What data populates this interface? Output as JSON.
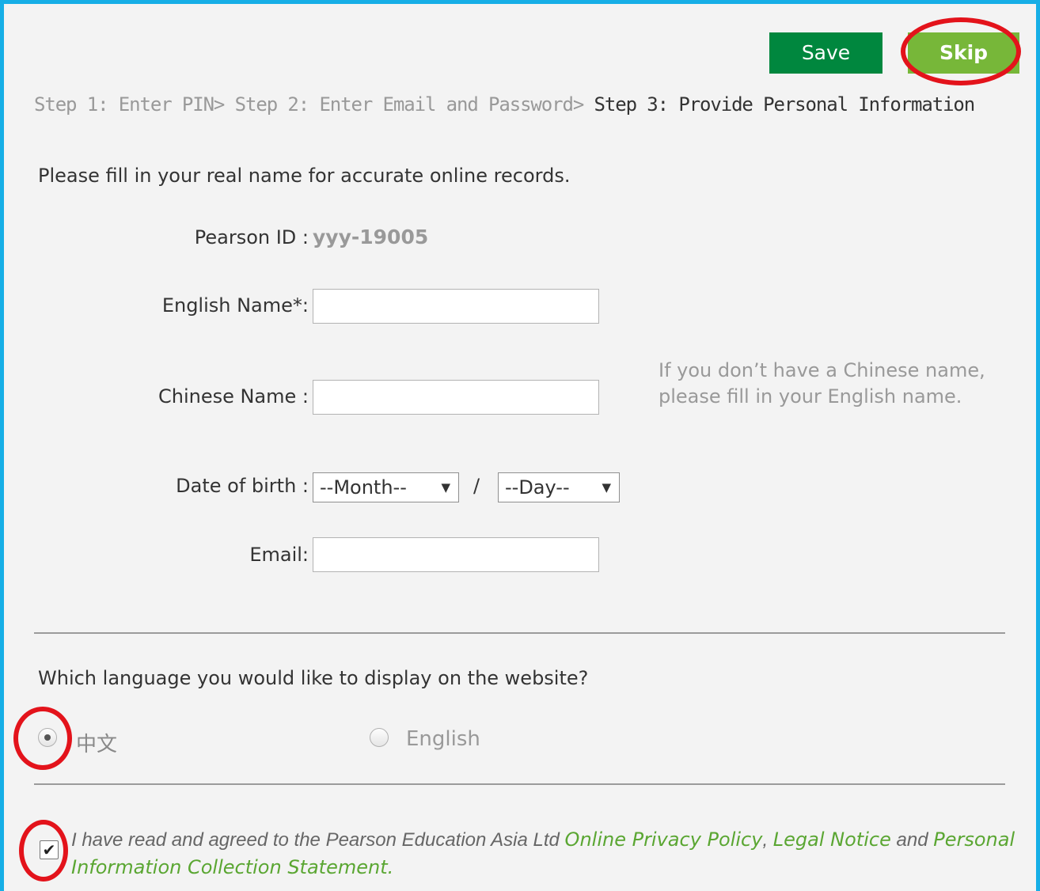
{
  "toolbar": {
    "save_label": "Save",
    "skip_label": "Skip"
  },
  "steps": {
    "step1": "Step 1: Enter PIN>",
    "step2": "Step 2: Enter Email and Password>",
    "step3": "Step 3: Provide Personal Information"
  },
  "intro": "Please fill in your real name for accurate online records.",
  "form": {
    "pearson_id_label": "Pearson ID :",
    "pearson_id_value": "yyy-19005",
    "english_name_label": "English Name*:",
    "english_name_value": "",
    "chinese_name_label": "Chinese Name :",
    "chinese_name_value": "",
    "chinese_name_hint": "If you don’t have a Chinese name, please fill in your English name.",
    "dob_label": "Date of birth :",
    "month_selected": "--Month--",
    "dob_separator": "/",
    "day_selected": "--Day--",
    "email_label": "Email:",
    "email_value": ""
  },
  "language": {
    "question": "Which language you would like to display on the website?",
    "options": [
      {
        "label": "中文",
        "checked": true
      },
      {
        "label": "English",
        "checked": false
      }
    ]
  },
  "agreement": {
    "checked": true,
    "text_before": "I have read and agreed to the Pearson Education Asia Ltd ",
    "link_privacy": "Online Privacy Policy",
    "comma": ", ",
    "link_legal": "Legal Notice",
    "and": " and ",
    "link_pics": "Personal Information Collection Statement.",
    "checkmark": "✔"
  },
  "colors": {
    "border": "#16aee6",
    "save_button": "#00873e",
    "skip_button": "#77b739",
    "annotation": "#e3131b",
    "link": "#5aa632"
  }
}
